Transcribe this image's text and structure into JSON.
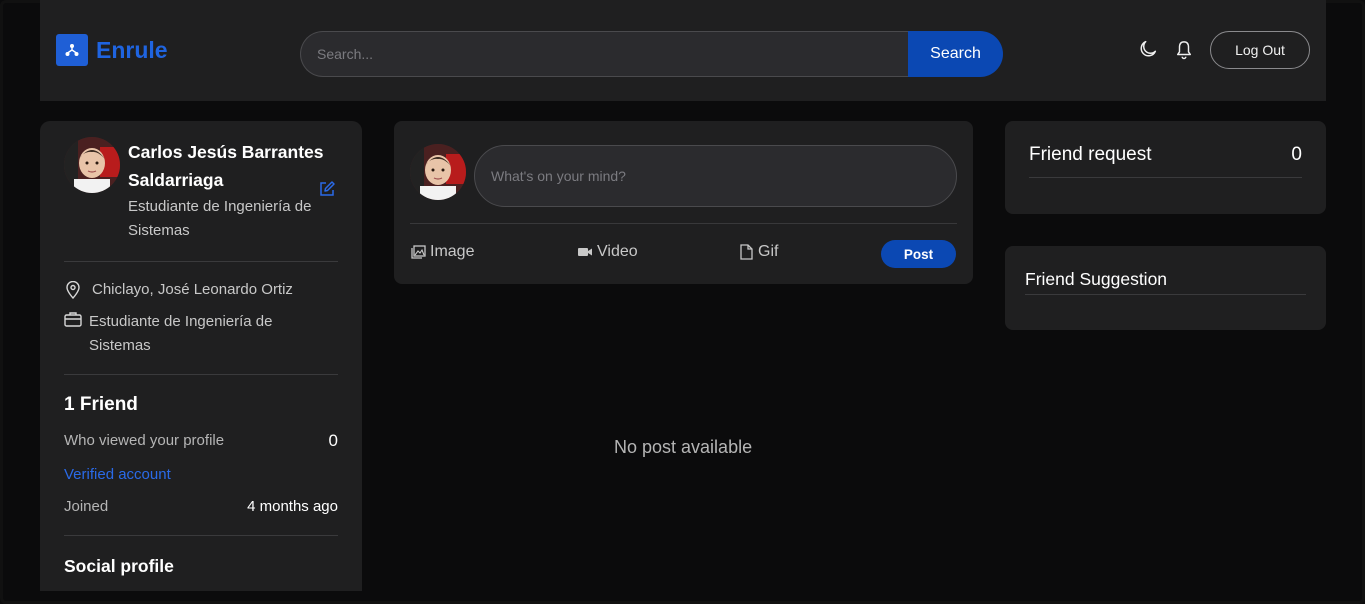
{
  "app": {
    "name": "Enrule",
    "accent": "#1f64e0",
    "button_color": "#0b48b3"
  },
  "header": {
    "search_placeholder": "Search...",
    "search_button": "Search",
    "logout_label": "Log Out",
    "icons": [
      "network-icon",
      "moon-icon",
      "bell-icon"
    ]
  },
  "profile": {
    "name": "Carlos Jesús Barrantes Saldarriaga",
    "role": "Estudiante de Ingeniería de Sistemas",
    "location": "Chiclayo, José Leonardo Ortiz",
    "occupation": "Estudiante de Ingeniería de Sistemas",
    "friends": "1 Friend",
    "viewed_label": "Who viewed your profile",
    "viewed_value": "0",
    "verified": "Verified account",
    "joined_label": "Joined",
    "joined_value": "4 months ago",
    "social_title": "Social profile"
  },
  "composer": {
    "placeholder": "What's on your mind?",
    "image_label": "Image",
    "video_label": "Video",
    "gif_label": "Gif",
    "post_label": "Post"
  },
  "feed": {
    "empty_text": "No post available"
  },
  "friend_request": {
    "title": "Friend request",
    "count": "0"
  },
  "friend_suggestion": {
    "title": "Friend Suggestion"
  }
}
